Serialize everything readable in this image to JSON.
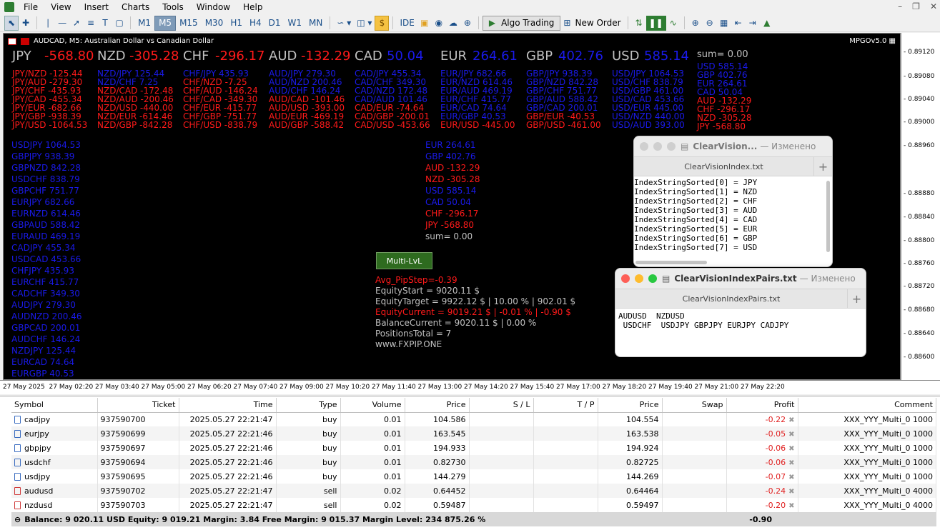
{
  "menu": {
    "items": [
      "File",
      "View",
      "Insert",
      "Charts",
      "Tools",
      "Window",
      "Help"
    ]
  },
  "toolbar": {
    "timeframes": [
      "M1",
      "M5",
      "M15",
      "M30",
      "H1",
      "H4",
      "D1",
      "W1",
      "MN"
    ],
    "active_timeframe": "M5",
    "ide_label": "IDE",
    "algo_label": "Algo Trading",
    "new_order_label": "New Order"
  },
  "chart": {
    "symbol_title": "AUDCAD, M5:  Australian Dollar vs Canadian Dollar",
    "indicator": "MPGOv5.0",
    "currencies": [
      {
        "name": "JPY",
        "value": "-568.80",
        "color": "#ff1a1a"
      },
      {
        "name": "NZD",
        "value": "-305.28",
        "color": "#ff1a1a"
      },
      {
        "name": "CHF",
        "value": "-296.17",
        "color": "#ff1a1a"
      },
      {
        "name": "AUD",
        "value": "-132.29",
        "color": "#ff1a1a"
      },
      {
        "name": "CAD",
        "value": "50.04",
        "color": "#1a1ae8"
      },
      {
        "name": "EUR",
        "value": "264.61",
        "color": "#1a1ae8"
      },
      {
        "name": "GBP",
        "value": "402.76",
        "color": "#1a1ae8"
      },
      {
        "name": "USD",
        "value": "585.14",
        "color": "#1a1ae8"
      }
    ],
    "sum_label": "sum= 0.00",
    "pair_columns": [
      [
        {
          "t": "JPY/NZD -125.44",
          "c": "red"
        },
        {
          "t": "JPY/AUD -279.30",
          "c": "red"
        },
        {
          "t": "JPY/CHF -435.93",
          "c": "red"
        },
        {
          "t": "JPY/CAD -455.34",
          "c": "red"
        },
        {
          "t": "JPY/EUR -682.66",
          "c": "red"
        },
        {
          "t": "JPY/GBP -938.39",
          "c": "red"
        },
        {
          "t": "JPY/USD -1064.53",
          "c": "red"
        }
      ],
      [
        {
          "t": "NZD/JPY 125.44",
          "c": "blue"
        },
        {
          "t": "NZD/CHF 7.25",
          "c": "blue"
        },
        {
          "t": "NZD/CAD -172.48",
          "c": "red"
        },
        {
          "t": "NZD/AUD -200.46",
          "c": "red"
        },
        {
          "t": "NZD/USD -440.00",
          "c": "red"
        },
        {
          "t": "NZD/EUR -614.46",
          "c": "red"
        },
        {
          "t": "NZD/GBP -842.28",
          "c": "red"
        }
      ],
      [
        {
          "t": "CHF/JPY 435.93",
          "c": "blue"
        },
        {
          "t": "CHF/NZD -7.25",
          "c": "red"
        },
        {
          "t": "CHF/AUD -146.24",
          "c": "red"
        },
        {
          "t": "CHF/CAD -349.30",
          "c": "red"
        },
        {
          "t": "CHF/EUR -415.77",
          "c": "red"
        },
        {
          "t": "CHF/GBP -751.77",
          "c": "red"
        },
        {
          "t": "CHF/USD -838.79",
          "c": "red"
        }
      ],
      [
        {
          "t": "AUD/JPY 279.30",
          "c": "blue"
        },
        {
          "t": "AUD/NZD 200.46",
          "c": "blue"
        },
        {
          "t": "AUD/CHF 146.24",
          "c": "blue"
        },
        {
          "t": "AUD/CAD -101.46",
          "c": "red"
        },
        {
          "t": "AUD/USD -393.00",
          "c": "red"
        },
        {
          "t": "AUD/EUR -469.19",
          "c": "red"
        },
        {
          "t": "AUD/GBP -588.42",
          "c": "red"
        }
      ],
      [
        {
          "t": "CAD/JPY 455.34",
          "c": "blue"
        },
        {
          "t": "CAD/CHF 349.30",
          "c": "blue"
        },
        {
          "t": "CAD/NZD 172.48",
          "c": "blue"
        },
        {
          "t": "CAD/AUD 101.46",
          "c": "blue"
        },
        {
          "t": "CAD/EUR -74.64",
          "c": "red"
        },
        {
          "t": "CAD/GBP -200.01",
          "c": "red"
        },
        {
          "t": "CAD/USD -453.66",
          "c": "red"
        }
      ],
      [
        {
          "t": "EUR/JPY 682.66",
          "c": "blue"
        },
        {
          "t": "EUR/NZD 614.46",
          "c": "blue"
        },
        {
          "t": "EUR/AUD 469.19",
          "c": "blue"
        },
        {
          "t": "EUR/CHF 415.77",
          "c": "blue"
        },
        {
          "t": "EUR/CAD 74.64",
          "c": "blue"
        },
        {
          "t": "EUR/GBP 40.53",
          "c": "blue"
        },
        {
          "t": "EUR/USD -445.00",
          "c": "red"
        }
      ],
      [
        {
          "t": "GBP/JPY 938.39",
          "c": "blue"
        },
        {
          "t": "GBP/NZD 842.28",
          "c": "blue"
        },
        {
          "t": "GBP/CHF 751.77",
          "c": "blue"
        },
        {
          "t": "GBP/AUD 588.42",
          "c": "blue"
        },
        {
          "t": "GBP/CAD 200.01",
          "c": "blue"
        },
        {
          "t": "GBP/EUR -40.53",
          "c": "red"
        },
        {
          "t": "GBP/USD -461.00",
          "c": "red"
        }
      ],
      [
        {
          "t": "USD/JPY 1064.53",
          "c": "blue"
        },
        {
          "t": "USD/CHF 838.79",
          "c": "blue"
        },
        {
          "t": "USD/GBP 461.00",
          "c": "blue"
        },
        {
          "t": "USD/CAD 453.66",
          "c": "blue"
        },
        {
          "t": "USD/EUR 445.00",
          "c": "blue"
        },
        {
          "t": "USD/NZD 440.00",
          "c": "blue"
        },
        {
          "t": "USD/AUD 393.00",
          "c": "blue"
        }
      ],
      [
        {
          "t": "USD 585.14",
          "c": "blue"
        },
        {
          "t": "GBP 402.76",
          "c": "blue"
        },
        {
          "t": "EUR 264.61",
          "c": "blue"
        },
        {
          "t": "CAD 50.04",
          "c": "blue"
        },
        {
          "t": "AUD -132.29",
          "c": "red"
        },
        {
          "t": "CHF -296.17",
          "c": "red"
        },
        {
          "t": "NZD -305.28",
          "c": "red"
        },
        {
          "t": "JPY -568.80",
          "c": "red"
        }
      ]
    ],
    "sorted_pairs": [
      "USDJPY 1064.53",
      "GBPJPY 938.39",
      "GBPNZD 842.28",
      "USDCHF 838.79",
      "GBPCHF 751.77",
      "EURJPY 682.66",
      "EURNZD 614.46",
      "GBPAUD 588.42",
      "EURAUD 469.19",
      "CADJPY 455.34",
      "USDCAD 453.66",
      "CHFJPY 435.93",
      "EURCHF 415.77",
      "CADCHF 349.30",
      "AUDJPY 279.30",
      "AUDNZD 200.46",
      "GBPCAD 200.01",
      "AUDCHF 146.24",
      "NZDJPY 125.44",
      "EURCAD 74.64",
      "EURGBP 40.53"
    ],
    "middle_list": [
      {
        "t": "EUR 264.61",
        "c": "blue"
      },
      {
        "t": "GBP 402.76",
        "c": "blue"
      },
      {
        "t": "AUD -132.29",
        "c": "red"
      },
      {
        "t": "NZD -305.28",
        "c": "red"
      },
      {
        "t": "USD 585.14",
        "c": "blue"
      },
      {
        "t": "CAD 50.04",
        "c": "blue"
      },
      {
        "t": "CHF -296.17",
        "c": "red"
      },
      {
        "t": "JPY -568.80",
        "c": "red"
      },
      {
        "t": "sum= 0.00",
        "c": "gray"
      }
    ],
    "multi_button": "Multi-LvL",
    "stats": [
      {
        "t": "Avg_PipStep=-0.39",
        "c": "red"
      },
      {
        "t": "EquityStart      = 9020.11 $",
        "c": "gray"
      },
      {
        "t": "EquityTarget     = 9922.12 $ | 10.00 % | 902.01 $",
        "c": "gray"
      },
      {
        "t": "EquityCurrent  = 9019.21 $ | -0.01 % | -0.90 $",
        "c": "red"
      },
      {
        "t": "BalanceCurrent = 9020.11 $ | 0.00 %",
        "c": "gray"
      },
      {
        "t": "PositionsTotal    = 7",
        "c": "gray"
      },
      {
        "t": "www.FXPIP.ONE",
        "c": "gray"
      }
    ],
    "price_labels": [
      "0.89120",
      "0.89080",
      "0.89040",
      "0.89000",
      "0.88960",
      "0.88880",
      "0.88840",
      "0.88800",
      "0.88760",
      "0.88720",
      "0.88680",
      "0.88640",
      "0.88600"
    ],
    "time_labels": [
      "27 May 2025",
      "27 May 02:20",
      "27 May 03:40",
      "27 May 05:00",
      "27 May 06:20",
      "27 May 07:40",
      "27 May 09:00",
      "27 May 10:20",
      "27 May 11:40",
      "27 May 13:00",
      "27 May 14:20",
      "27 May 15:40",
      "27 May 17:00",
      "27 May 18:20",
      "27 May 19:40",
      "27 May 21:00",
      "27 May 22:20"
    ]
  },
  "window1": {
    "title": "ClearVision...",
    "changed": "— Изменено",
    "tab": "ClearVisionIndex.txt",
    "lines": [
      "IndexStringSorted[0] = JPY",
      "IndexStringSorted[1] = NZD",
      "IndexStringSorted[2] = CHF",
      "IndexStringSorted[3] = AUD",
      "IndexStringSorted[4] = CAD",
      "IndexStringSorted[5] = EUR",
      "IndexStringSorted[6] = GBP",
      "IndexStringSorted[7] = USD"
    ]
  },
  "window2": {
    "title": "ClearVisionIndexPairs.txt",
    "changed": "— Изменено",
    "tab": "ClearVisionIndexPairs.txt",
    "lines": [
      "AUDUSD  NZDUSD",
      " USDCHF  USDJPY GBPJPY EURJPY CADJPY"
    ]
  },
  "trades": {
    "headers": [
      "Symbol",
      "Ticket",
      "Time",
      "Type",
      "Volume",
      "Price",
      "S / L",
      "T / P",
      "Price",
      "Swap",
      "Profit",
      "Comment"
    ],
    "rows": [
      {
        "symbol": "cadjpy",
        "ticket": "937590700",
        "time": "2025.05.27 22:21:47",
        "type": "buy",
        "volume": "0.01",
        "price": "104.586",
        "sl": "",
        "tp": "",
        "cur": "104.554",
        "swap": "",
        "profit": "-0.22",
        "comment": "XXX_YYY_Multi_0 1000"
      },
      {
        "symbol": "eurjpy",
        "ticket": "937590699",
        "time": "2025.05.27 22:21:46",
        "type": "buy",
        "volume": "0.01",
        "price": "163.545",
        "sl": "",
        "tp": "",
        "cur": "163.538",
        "swap": "",
        "profit": "-0.05",
        "comment": "XXX_YYY_Multi_0 1000"
      },
      {
        "symbol": "gbpjpy",
        "ticket": "937590697",
        "time": "2025.05.27 22:21:46",
        "type": "buy",
        "volume": "0.01",
        "price": "194.933",
        "sl": "",
        "tp": "",
        "cur": "194.924",
        "swap": "",
        "profit": "-0.06",
        "comment": "XXX_YYY_Multi_0 1000"
      },
      {
        "symbol": "usdchf",
        "ticket": "937590694",
        "time": "2025.05.27 22:21:46",
        "type": "buy",
        "volume": "0.01",
        "price": "0.82730",
        "sl": "",
        "tp": "",
        "cur": "0.82725",
        "swap": "",
        "profit": "-0.06",
        "comment": "XXX_YYY_Multi_0 1000"
      },
      {
        "symbol": "usdjpy",
        "ticket": "937590695",
        "time": "2025.05.27 22:21:46",
        "type": "buy",
        "volume": "0.01",
        "price": "144.279",
        "sl": "",
        "tp": "",
        "cur": "144.269",
        "swap": "",
        "profit": "-0.07",
        "comment": "XXX_YYY_Multi_0 1000"
      },
      {
        "symbol": "audusd",
        "ticket": "937590702",
        "time": "2025.05.27 22:21:47",
        "type": "sell",
        "volume": "0.02",
        "price": "0.64452",
        "sl": "",
        "tp": "",
        "cur": "0.64464",
        "swap": "",
        "profit": "-0.24",
        "comment": "XXX_YYY_Multi_0 4000"
      },
      {
        "symbol": "nzdusd",
        "ticket": "937590703",
        "time": "2025.05.27 22:21:47",
        "type": "sell",
        "volume": "0.02",
        "price": "0.59487",
        "sl": "",
        "tp": "",
        "cur": "0.59497",
        "swap": "",
        "profit": "-0.20",
        "comment": "XXX_YYY_Multi_0 4000"
      }
    ],
    "balance_line": "Balance: 9 020.11 USD  Equity: 9 019.21  Margin: 3.84  Free Margin: 9 015.37  Margin Level: 234 875.26 %",
    "total_profit": "-0.90"
  }
}
